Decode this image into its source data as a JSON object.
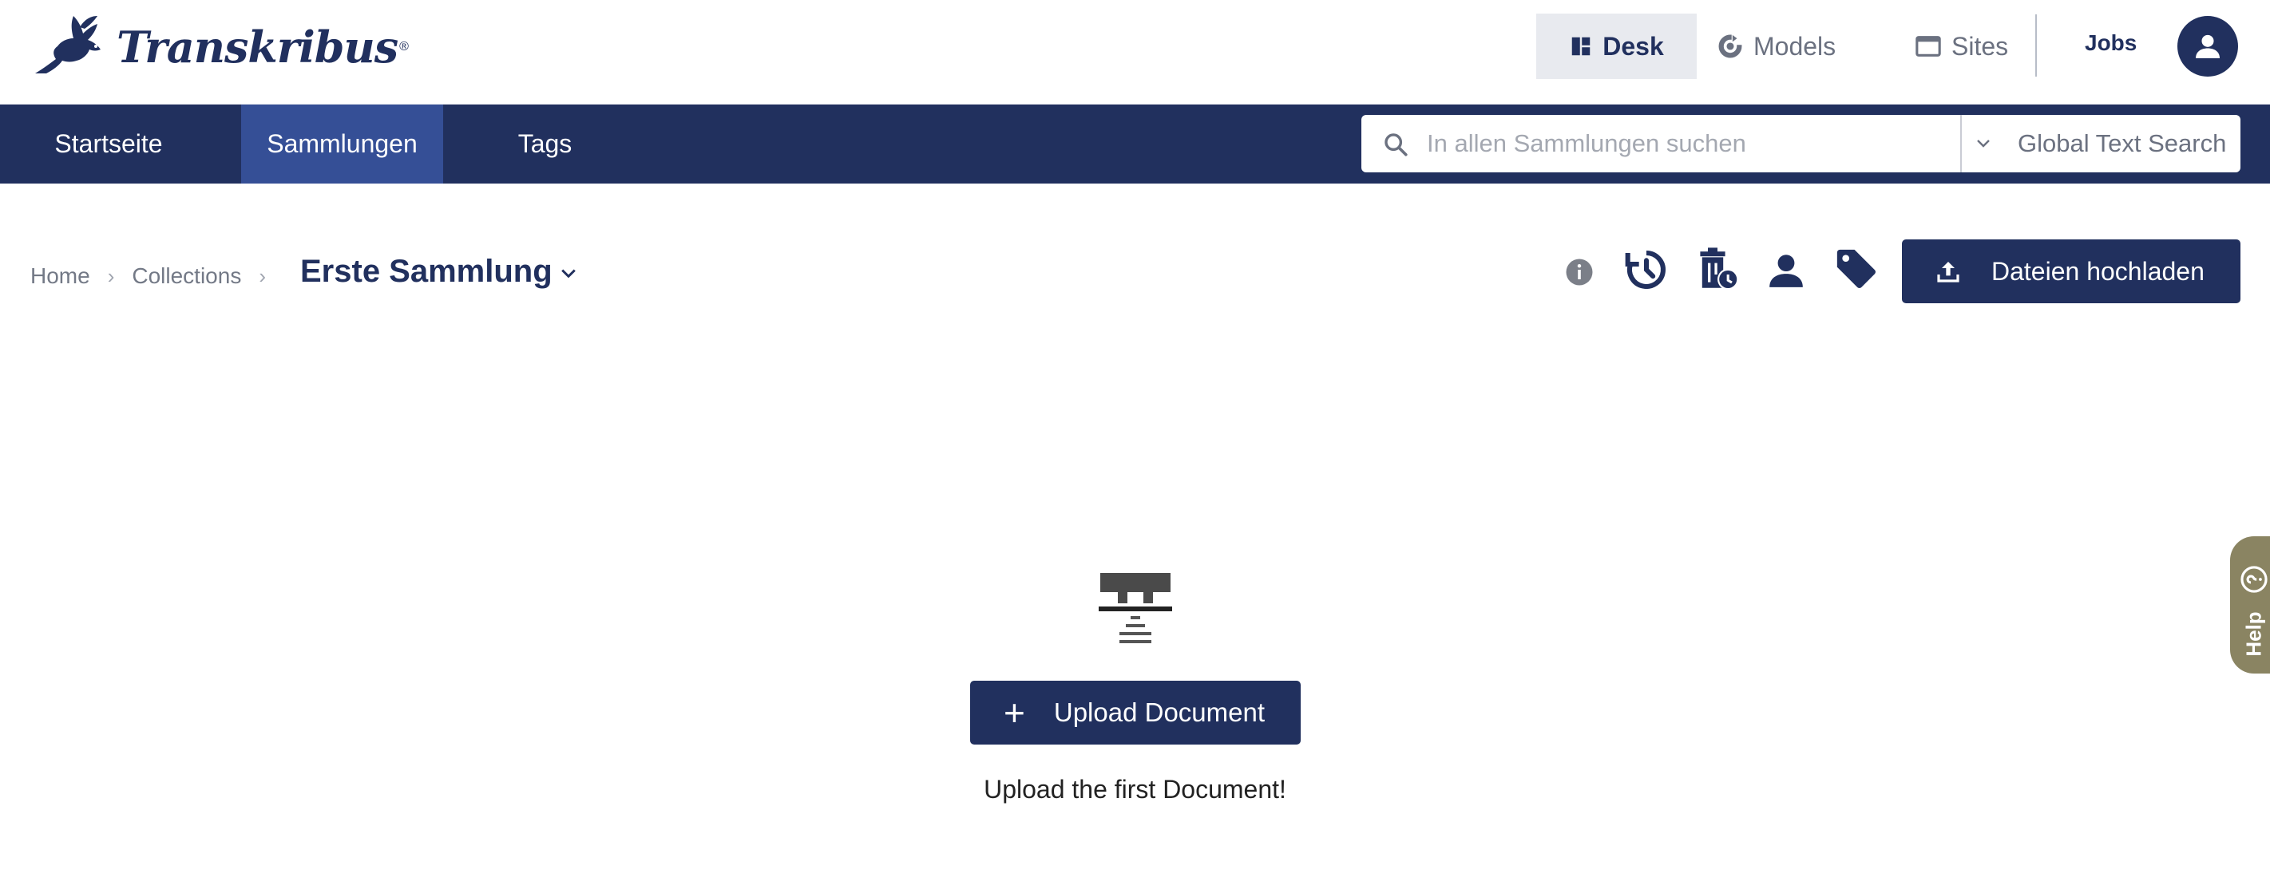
{
  "header": {
    "logo_text": "Transkribus",
    "nav": [
      {
        "label": "Desk",
        "icon": "dashboard-icon",
        "active": true
      },
      {
        "label": "Models",
        "icon": "models-icon"
      },
      {
        "label": "Sites",
        "icon": "browser-window-icon"
      }
    ],
    "jobs_label": "Jobs",
    "avatar_icon": "user-icon"
  },
  "subnav": {
    "tabs": [
      {
        "label": "Startseite"
      },
      {
        "label": "Sammlungen",
        "active": true
      },
      {
        "label": "Tags"
      }
    ],
    "search": {
      "placeholder": "In allen Sammlungen suchen",
      "value": "",
      "mode_label": "Global Text Search"
    }
  },
  "breadcrumb": {
    "items": [
      "Home",
      "Collections"
    ],
    "current": "Erste Sammlung"
  },
  "toolbar": {
    "icons": [
      "info-icon",
      "history-icon",
      "trash-schedule-icon",
      "person-icon",
      "tag-icon"
    ],
    "upload_label": "Dateien hochladen"
  },
  "empty_state": {
    "button_label": "Upload Document",
    "message": "Upload the first Document!"
  },
  "help": {
    "label": "Help"
  },
  "colors": {
    "primary": "#21305e",
    "active_tab": "#354f96",
    "help_tab": "#8a8462",
    "nav_active_bg": "#e8eaef"
  }
}
